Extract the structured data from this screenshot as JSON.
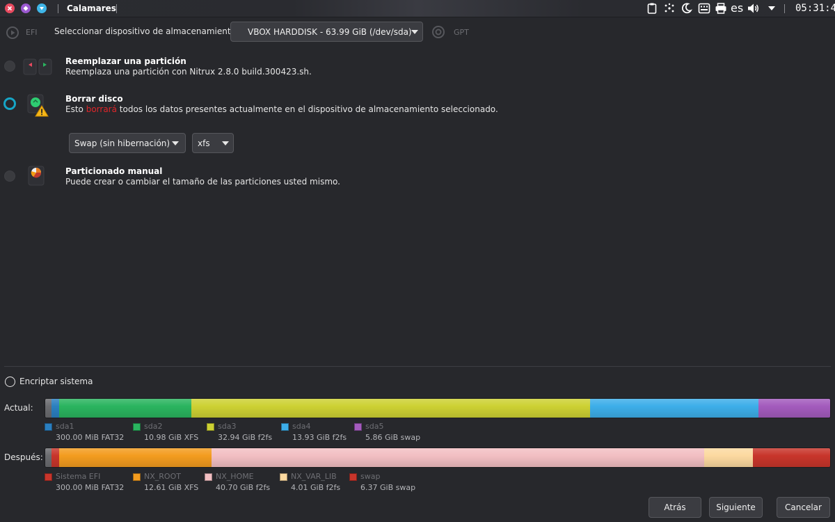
{
  "topbar": {
    "app_title": "Calamares",
    "language": "es",
    "clock": "05:31:49",
    "window_buttons": [
      "close-icon",
      "minimize-icon",
      "maximize-icon"
    ],
    "tray_icons": [
      "clipboard-icon",
      "network-icon",
      "night-light-icon",
      "keyboard-icon",
      "printer-icon",
      "volume-icon",
      "menu-arrow-icon"
    ]
  },
  "header": {
    "efi_label": "EFI",
    "device_label": "Seleccionar dispositivo de almacenamiento:",
    "device_value": "VBOX HARDDISK - 63.99 GiB (/dev/sda)",
    "gpt_label": "GPT"
  },
  "options": {
    "replace": {
      "title": "Reemplazar una partición",
      "desc": "Reemplaza una partición con Nitrux 2.8.0 build.300423.sh."
    },
    "erase": {
      "title": "Borrar disco",
      "desc_prefix": "Esto ",
      "desc_red": "borrará",
      "desc_suffix": " todos los datos presentes actualmente en el dispositivo de almacenamiento seleccionado.",
      "swap_value": "Swap (sin hibernación)",
      "fs_value": "xfs"
    },
    "manual": {
      "title": "Particionado manual",
      "desc": "Puede crear o cambiar el tamaño de las particiones usted mismo."
    }
  },
  "encrypt_label": "Encriptar sistema",
  "current": {
    "label": "Actual:",
    "partitions": [
      {
        "name": "sda1",
        "size": "300.00 MiB FAT32",
        "color": "#2a7fc0"
      },
      {
        "name": "sda2",
        "size": "10.98 GiB XFS",
        "color": "#2ab45f"
      },
      {
        "name": "sda3",
        "size": "32.94 GiB f2fs",
        "color": "#cdd133"
      },
      {
        "name": "sda4",
        "size": "13.93 GiB f2fs",
        "color": "#3daee9"
      },
      {
        "name": "sda5",
        "size": "5.86 GiB swap",
        "color": "#a35bbd"
      }
    ]
  },
  "after": {
    "label": "Después:",
    "partitions": [
      {
        "name": "Sistema EFI",
        "size": "300.00 MiB FAT32",
        "color": "#c8352b"
      },
      {
        "name": "NX_ROOT",
        "size": "12.61 GiB XFS",
        "color": "#f39c1f"
      },
      {
        "name": "NX_HOME",
        "size": "40.70 GiB f2fs",
        "color": "#f2bfc3"
      },
      {
        "name": "NX_VAR_LIB",
        "size": "4.01 GiB f2fs",
        "color": "#fcd9a0"
      },
      {
        "name": "swap",
        "size": "6.37 GiB swap",
        "color": "#c8352b"
      }
    ]
  },
  "buttons": {
    "back": "Atrás",
    "next": "Siguiente",
    "cancel": "Cancelar"
  }
}
